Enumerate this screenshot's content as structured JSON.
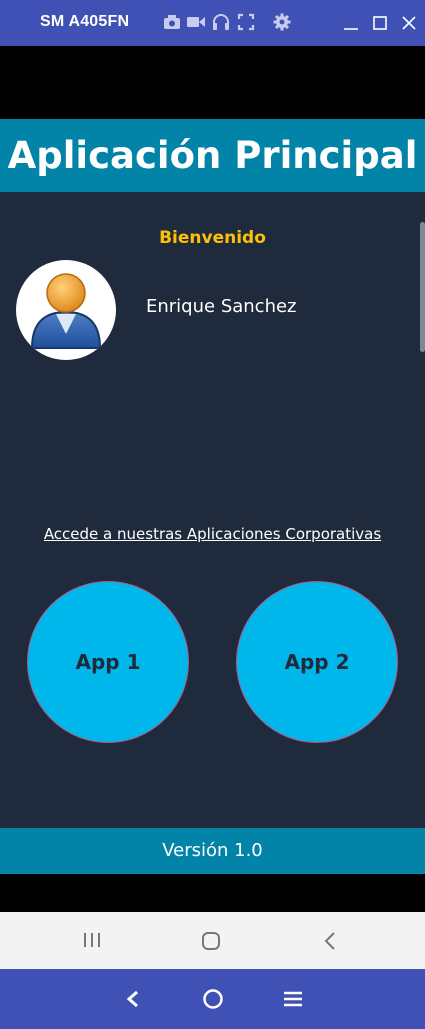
{
  "window": {
    "device_name": "SM A405FN"
  },
  "toolbar_icons": [
    "camera-icon",
    "video-icon",
    "headphones-icon",
    "fullscreen-icon",
    "gear-icon"
  ],
  "window_controls": [
    "minimize-icon",
    "maximize-icon",
    "close-icon"
  ],
  "app": {
    "title": "Aplicación Principal",
    "welcome": "Bienvenido",
    "user_name": "Enrique Sanchez",
    "apps_link": "Accede a nuestras Aplicaciones Corporativas",
    "buttons": [
      {
        "label": "App 1"
      },
      {
        "label": "App 2"
      }
    ],
    "footer": "Versión 1.0"
  },
  "colors": {
    "emulator_bar": "#3f51b5",
    "app_header": "#0284a8",
    "app_background": "#1f2a3c",
    "accent_welcome": "#ffc107",
    "app_button": "#00b7eb"
  }
}
